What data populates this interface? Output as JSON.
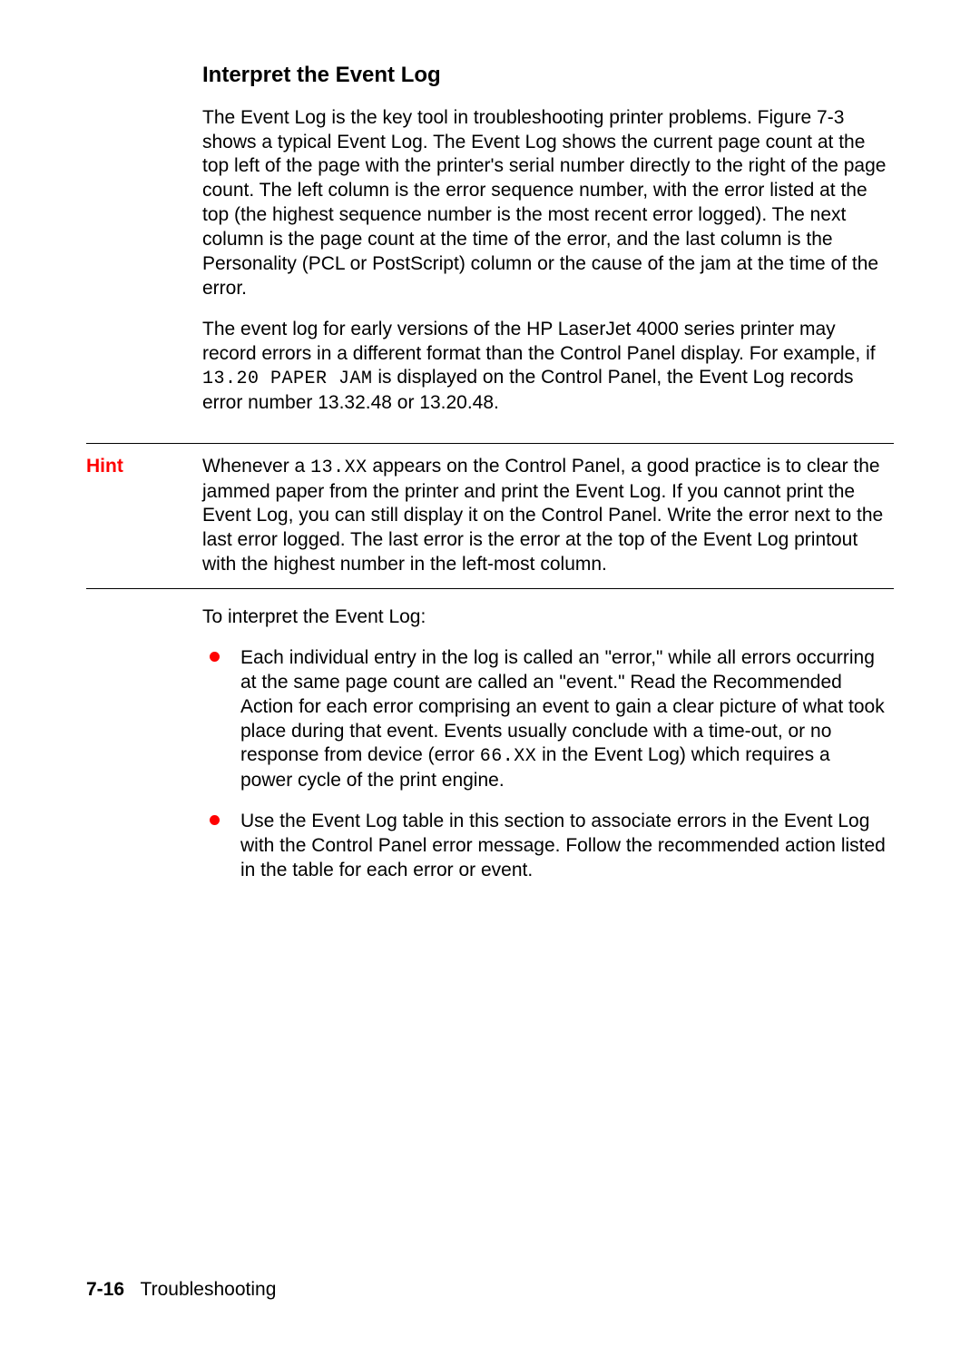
{
  "heading": "Interpret the Event Log",
  "para1": "The Event Log is the key tool in troubleshooting printer problems. Figure 7-3 shows a typical Event Log. The Event Log shows the current page count at the top left of the page with the printer's serial number directly to the right of the page count. The left column is the error sequence number, with the error listed at the top (the highest sequence number is the most recent error logged). The next column is the page count at the time of the error, and the last column is the Personality (PCL or PostScript) column or the cause of the jam at the time of the error.",
  "para2_a": "The event log for early versions of the HP LaserJet 4000 series printer may record errors in a different format than the Control Panel display. For example, if ",
  "para2_code": "13.20 PAPER JAM",
  "para2_b": " is displayed on the Control Panel, the Event Log records error number 13.32.48 or 13.20.48.",
  "hint_label": "Hint",
  "hint_a": "Whenever a ",
  "hint_code": "13.XX",
  "hint_b": " appears on the Control Panel, a good practice is to clear the jammed paper from the printer and print the Event Log. If you cannot print the Event Log, you can still display it on the Control Panel. Write the error next to the last error logged. The last error is the error at the top of the Event Log printout with the highest number in the left-most column.",
  "list_intro": "To interpret the Event Log:",
  "bullet1_a": "Each individual entry in the log is called an \"error,\" while all errors occurring at the same page count are called an \"event.\" Read the Recommended Action for each error comprising an event to gain a clear picture of what took place during that event. Events usually conclude with a time-out, or no response from device (error ",
  "bullet1_code": "66.XX",
  "bullet1_b": " in the Event Log) which requires a power cycle of the print engine.",
  "bullet2": "Use the Event Log table in this section to associate errors in the Event Log with the Control Panel error message. Follow the recommended action listed in the table for each error or event.",
  "footer_page": "7-16",
  "footer_section": "Troubleshooting"
}
